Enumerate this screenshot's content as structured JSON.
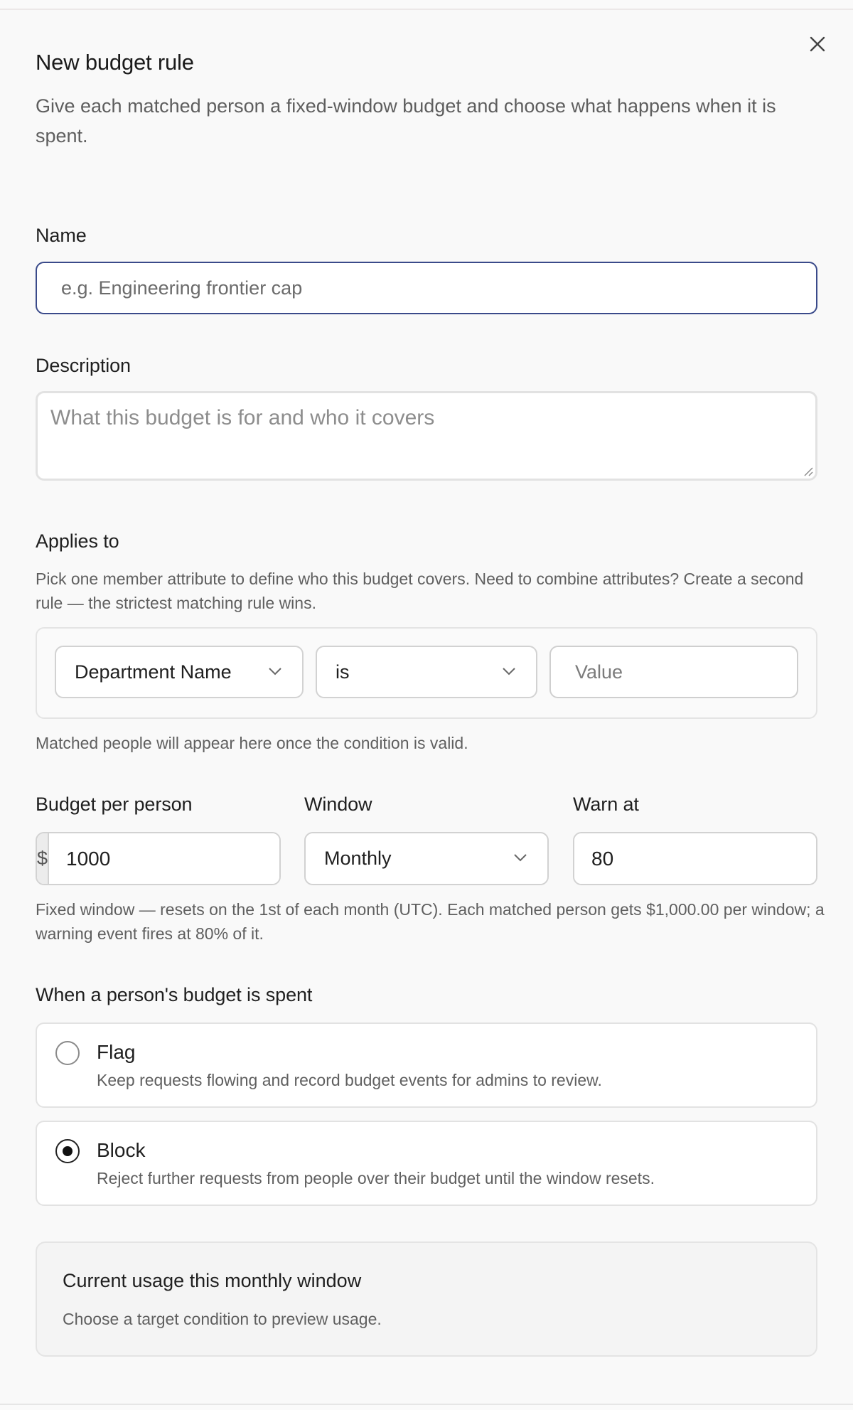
{
  "dialog": {
    "title": "New budget rule",
    "subtitle": "Give each matched person a fixed-window budget and choose what happens when it is spent."
  },
  "name_field": {
    "label": "Name",
    "value": "",
    "placeholder": "e.g. Engineering frontier cap"
  },
  "description_field": {
    "label": "Description",
    "value": "",
    "placeholder": "What this budget is for and who it covers"
  },
  "applies_to": {
    "label": "Applies to",
    "help": "Pick one member attribute to define who this budget covers. Need to combine attributes? Create a second rule — the strictest matching rule wins.",
    "attribute": "Department Name",
    "operator": "is",
    "value": "",
    "value_placeholder": "Value",
    "matched_note": "Matched people will appear here once the condition is valid."
  },
  "budget": {
    "budget_label": "Budget per person",
    "currency_symbol": "$",
    "amount": "1000",
    "window_label": "Window",
    "window_value": "Monthly",
    "warn_label": "Warn at",
    "warn_value": "80",
    "warn_suffix": "%",
    "help": "Fixed window — resets on the 1st of each month (UTC). Each matched person gets $1,000.00 per window; a warning event fires at 80% of it."
  },
  "spent_action": {
    "label": "When a person's budget is spent",
    "options": [
      {
        "title": "Flag",
        "description": "Keep requests flowing and record budget events for admins to review.",
        "selected": false
      },
      {
        "title": "Block",
        "description": "Reject further requests from people over their budget until the window resets.",
        "selected": true
      }
    ]
  },
  "usage": {
    "title": "Current usage this monthly window",
    "description": "Choose a target condition to preview usage."
  },
  "colors": {
    "focus_border": "#3a4a8a",
    "text_primary": "#1f1f1f",
    "text_secondary": "#5f5f5f"
  }
}
